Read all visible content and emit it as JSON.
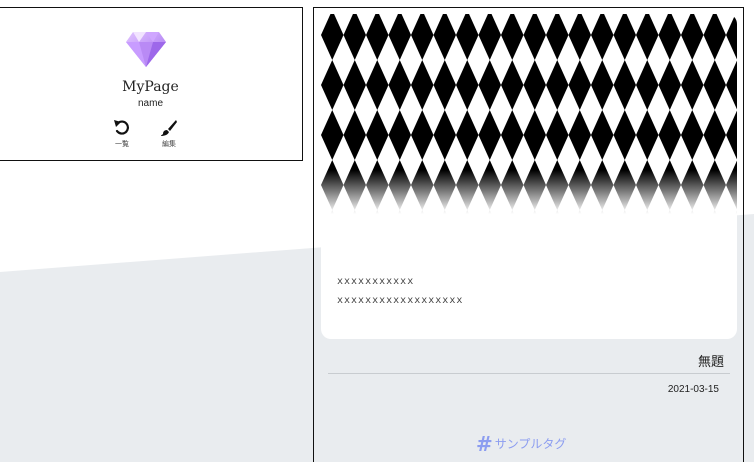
{
  "profile": {
    "title": "MyPage",
    "name": "name",
    "icon": "diamond-icon",
    "actions": [
      {
        "icon": "undo-icon",
        "label": "一覧"
      },
      {
        "icon": "brush-icon",
        "label": "編集"
      }
    ]
  },
  "article": {
    "thumbnail_lines": [
      "xxxxxxxxxxx",
      "xxxxxxxxxxxxxxxxxx"
    ],
    "title": "無題",
    "date": "2021-03-15",
    "tag": {
      "symbol": "#",
      "label": "サンプルタグ"
    }
  },
  "colors": {
    "tag": "#8c9df0",
    "background_accent": "#e9ecef",
    "gem_light": "#d8b8ff",
    "gem_dark": "#b27cf0"
  }
}
